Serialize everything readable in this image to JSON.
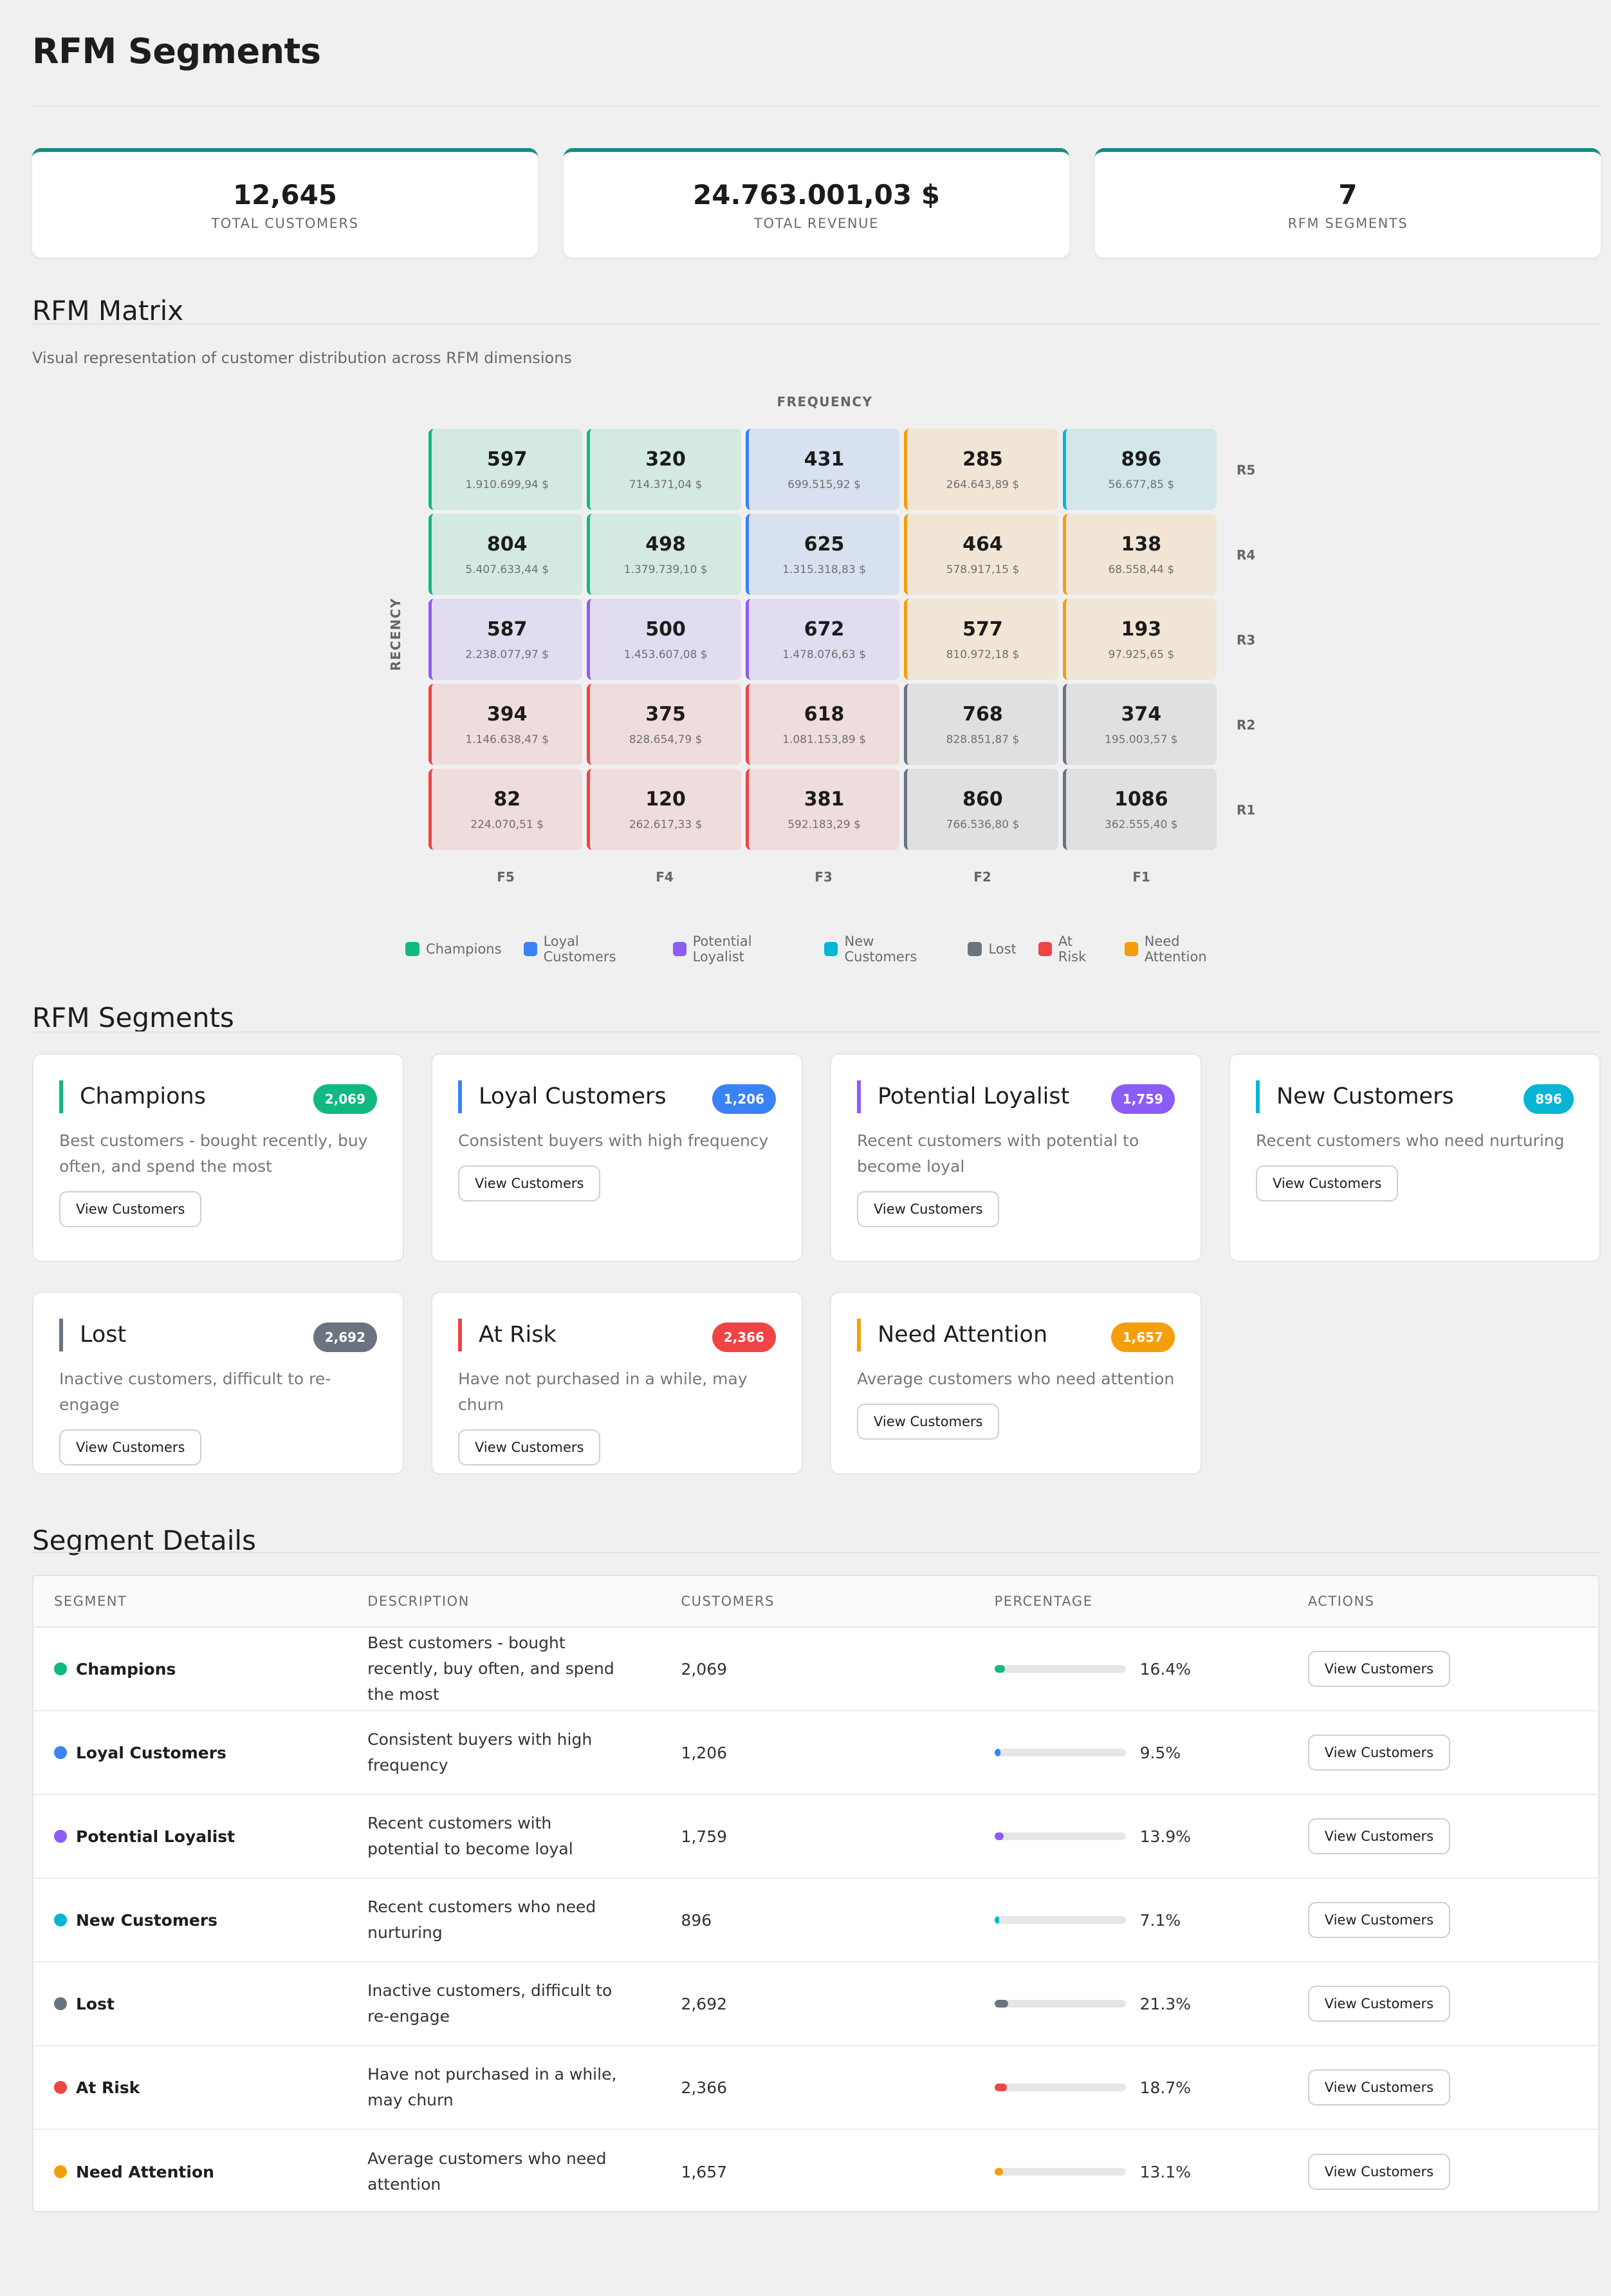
{
  "page": {
    "title": "RFM Segments"
  },
  "stats": [
    {
      "value": "12,645",
      "label": "TOTAL CUSTOMERS"
    },
    {
      "value": "24.763.001,03 $",
      "label": "TOTAL REVENUE"
    },
    {
      "value": "7",
      "label": "RFM SEGMENTS"
    }
  ],
  "matrix": {
    "title": "RFM Matrix",
    "subtitle": "Visual representation of customer distribution across RFM dimensions",
    "frequency_label": "FREQUENCY",
    "recency_label": "RECENCY",
    "col_labels": [
      "F5",
      "F4",
      "F3",
      "F2",
      "F1"
    ],
    "row_labels": [
      "R5",
      "R4",
      "R3",
      "R2",
      "R1"
    ],
    "rows": [
      [
        {
          "count": "597",
          "revenue": "1.910.699,94 $",
          "segment": "champions"
        },
        {
          "count": "320",
          "revenue": "714.371,04 $",
          "segment": "champions"
        },
        {
          "count": "431",
          "revenue": "699.515,92 $",
          "segment": "loyal"
        },
        {
          "count": "285",
          "revenue": "264.643,89 $",
          "segment": "attention"
        },
        {
          "count": "896",
          "revenue": "56.677,85 $",
          "segment": "new"
        }
      ],
      [
        {
          "count": "804",
          "revenue": "5.407.633,44 $",
          "segment": "champions"
        },
        {
          "count": "498",
          "revenue": "1.379.739,10 $",
          "segment": "champions"
        },
        {
          "count": "625",
          "revenue": "1.315.318,83 $",
          "segment": "loyal"
        },
        {
          "count": "464",
          "revenue": "578.917,15 $",
          "segment": "attention"
        },
        {
          "count": "138",
          "revenue": "68.558,44 $",
          "segment": "attention"
        }
      ],
      [
        {
          "count": "587",
          "revenue": "2.238.077,97 $",
          "segment": "potential"
        },
        {
          "count": "500",
          "revenue": "1.453.607,08 $",
          "segment": "potential"
        },
        {
          "count": "672",
          "revenue": "1.478.076,63 $",
          "segment": "potential"
        },
        {
          "count": "577",
          "revenue": "810.972,18 $",
          "segment": "attention"
        },
        {
          "count": "193",
          "revenue": "97.925,65 $",
          "segment": "attention"
        }
      ],
      [
        {
          "count": "394",
          "revenue": "1.146.638,47 $",
          "segment": "risk"
        },
        {
          "count": "375",
          "revenue": "828.654,79 $",
          "segment": "risk"
        },
        {
          "count": "618",
          "revenue": "1.081.153,89 $",
          "segment": "risk"
        },
        {
          "count": "768",
          "revenue": "828.851,87 $",
          "segment": "lost"
        },
        {
          "count": "374",
          "revenue": "195.003,57 $",
          "segment": "lost"
        }
      ],
      [
        {
          "count": "82",
          "revenue": "224.070,51 $",
          "segment": "risk"
        },
        {
          "count": "120",
          "revenue": "262.617,33 $",
          "segment": "risk"
        },
        {
          "count": "381",
          "revenue": "592.183,29 $",
          "segment": "risk"
        },
        {
          "count": "860",
          "revenue": "766.536,80 $",
          "segment": "lost"
        },
        {
          "count": "1086",
          "revenue": "362.555,40 $",
          "segment": "lost"
        }
      ]
    ],
    "legend": [
      {
        "label": "Champions",
        "segment": "champions"
      },
      {
        "label": "Loyal Customers",
        "segment": "loyal"
      },
      {
        "label": "Potential Loyalist",
        "segment": "potential"
      },
      {
        "label": "New Customers",
        "segment": "new"
      },
      {
        "label": "Lost",
        "segment": "lost"
      },
      {
        "label": "At Risk",
        "segment": "risk"
      },
      {
        "label": "Need Attention",
        "segment": "attention"
      }
    ]
  },
  "colors": {
    "champions": {
      "accent": "#10b981",
      "bg": "#d4e9e0"
    },
    "loyal": {
      "accent": "#3b82f6",
      "bg": "#d8e1ef"
    },
    "potential": {
      "accent": "#8b5cf6",
      "bg": "#e1dcef"
    },
    "new": {
      "accent": "#06b6d4",
      "bg": "#d3e7eb"
    },
    "lost": {
      "accent": "#6b7280",
      "bg": "#dfe0e2"
    },
    "risk": {
      "accent": "#ef4444",
      "bg": "#efdcdc"
    },
    "attention": {
      "accent": "#f59e0b",
      "bg": "#f1e6d6"
    },
    "brand": "#168c84"
  },
  "segments_section": {
    "title": "RFM Segments",
    "button_label": "View Customers"
  },
  "segments": [
    {
      "key": "champions",
      "name": "Champions",
      "count": "2,069",
      "description": "Best customers - bought recently, buy often, and spend the most",
      "percentage": 16.4,
      "percentage_label": "16.4%"
    },
    {
      "key": "loyal",
      "name": "Loyal Customers",
      "count": "1,206",
      "description": "Consistent buyers with high frequency",
      "percentage": 9.5,
      "percentage_label": "9.5%"
    },
    {
      "key": "potential",
      "name": "Potential Loyalist",
      "count": "1,759",
      "description": "Recent customers with potential to become loyal",
      "percentage": 13.9,
      "percentage_label": "13.9%"
    },
    {
      "key": "new",
      "name": "New Customers",
      "count": "896",
      "description": "Recent customers who need nurturing",
      "percentage": 7.1,
      "percentage_label": "7.1%"
    },
    {
      "key": "lost",
      "name": "Lost",
      "count": "2,692",
      "description": "Inactive customers, difficult to re-engage",
      "percentage": 21.3,
      "percentage_label": "21.3%"
    },
    {
      "key": "risk",
      "name": "At Risk",
      "count": "2,366",
      "description": "Have not purchased in a while, may churn",
      "percentage": 18.7,
      "percentage_label": "18.7%"
    },
    {
      "key": "attention",
      "name": "Need Attention",
      "count": "1,657",
      "description": "Average customers who need attention",
      "percentage": 13.1,
      "percentage_label": "13.1%"
    }
  ],
  "details": {
    "title": "Segment Details",
    "headers": [
      "SEGMENT",
      "DESCRIPTION",
      "CUSTOMERS",
      "PERCENTAGE",
      "ACTIONS"
    ],
    "button_label": "View Customers"
  }
}
